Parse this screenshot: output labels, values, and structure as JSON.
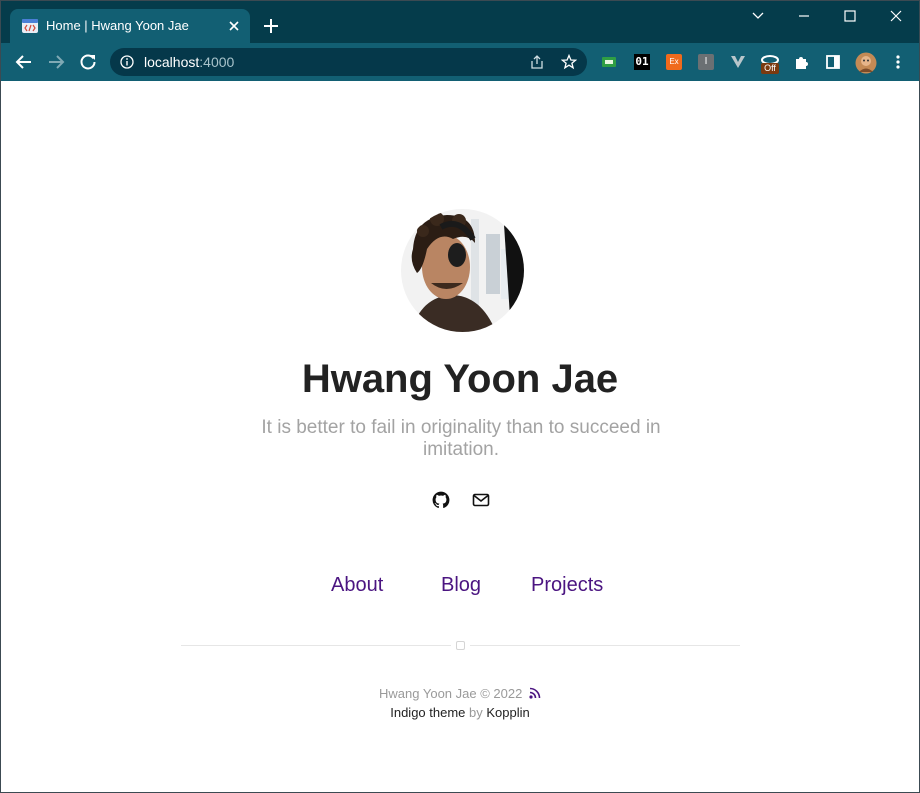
{
  "browser": {
    "tab_title": "Home | Hwang Yoon Jae",
    "url_host": "localhost",
    "url_port": ":4000",
    "theme_colors": {
      "tabstrip": "#053c4b",
      "toolbar": "#125f73",
      "omnibox": "#05384a"
    },
    "window_controls": [
      "chevron-down-icon",
      "minimize-icon",
      "maximize-icon",
      "close-icon"
    ],
    "toolbar_icons": [
      "back-icon",
      "forward-icon",
      "reload-icon",
      "info-icon",
      "share-icon",
      "star-icon"
    ],
    "extensions": [
      {
        "icon": "green-card-icon",
        "label": ""
      },
      {
        "icon": "binary-icon",
        "label": "01"
      },
      {
        "icon": "orange-box-icon",
        "label": "Ex"
      },
      {
        "icon": "gray-box-icon",
        "label": "I"
      },
      {
        "icon": "v-icon",
        "label": ""
      },
      {
        "icon": "off-badge-icon",
        "label": "Off"
      },
      {
        "icon": "puzzle-icon",
        "label": ""
      },
      {
        "icon": "sidepanel-icon",
        "label": ""
      },
      {
        "icon": "profile-avatar-icon",
        "label": ""
      },
      {
        "icon": "kebab-menu-icon",
        "label": ""
      }
    ]
  },
  "profile": {
    "name": "Hwang Yoon Jae",
    "tagline": "It is better to fail in originality than to succeed in imitation.",
    "social_icons": [
      "github-icon",
      "mail-icon"
    ]
  },
  "nav": {
    "links": [
      "About",
      "Blog",
      "Projects"
    ],
    "link_color": "#4b1581"
  },
  "footer": {
    "copyright": "Hwang Yoon Jae © 2022",
    "theme_name": "Indigo theme",
    "by": "by",
    "author": "Kopplin",
    "rss_icon": "rss-icon"
  }
}
